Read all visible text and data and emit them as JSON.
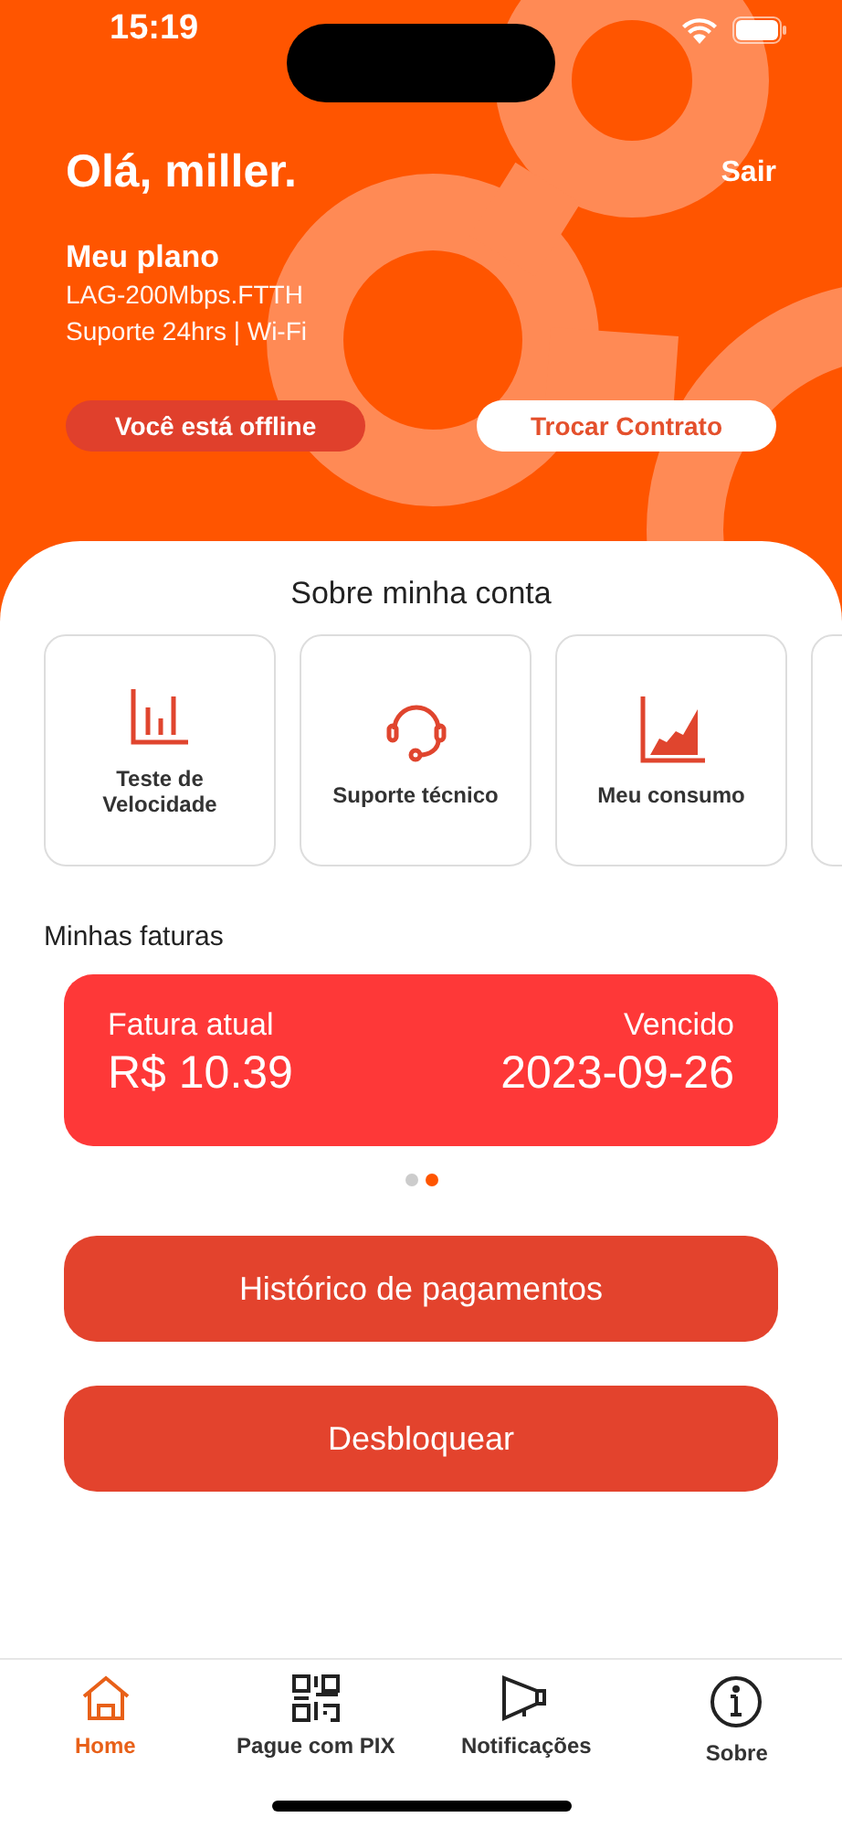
{
  "status_bar": {
    "time": "15:19"
  },
  "header": {
    "greeting": "Olá, miller.",
    "logout": "Sair",
    "plan_title": "Meu plano",
    "plan_lines": [
      "LAG-200Mbps.FTTH",
      "Suporte 24hrs | Wi-Fi"
    ],
    "offline_badge": "Você está offline",
    "switch_button": "Trocar Contrato"
  },
  "account": {
    "title": "Sobre minha conta",
    "tiles": [
      {
        "kind": "bars",
        "label": "Teste de Velocidade"
      },
      {
        "kind": "headset",
        "label": "Suporte técnico"
      },
      {
        "kind": "area",
        "label": "Meu consumo"
      }
    ]
  },
  "invoices": {
    "title": "Minhas faturas",
    "card": {
      "label": "Fatura atual",
      "amount": "R$ 10.39",
      "status": "Vencido",
      "date": "2023-09-26"
    },
    "pages": [
      {
        "selected": false
      },
      {
        "selected": true
      }
    ]
  },
  "actions": [
    "Histórico de pagamentos",
    "Desbloquear"
  ],
  "tabs": [
    {
      "kind": "home",
      "label": "Home",
      "selected": true
    },
    {
      "kind": "qr",
      "label": "Pague com PIX",
      "selected": false
    },
    {
      "kind": "megaphone",
      "label": "Notificações",
      "selected": false
    },
    {
      "kind": "info",
      "label": "Sobre",
      "selected": false
    }
  ]
}
